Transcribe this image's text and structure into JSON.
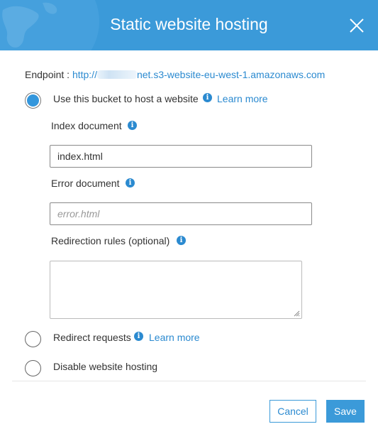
{
  "dialog": {
    "title": "Static website hosting",
    "close_icon": "close-icon"
  },
  "endpoint": {
    "label": "Endpoint : ",
    "url_prefix": "http://",
    "url_suffix": "net.s3-website-eu-west-1.amazonaws.com"
  },
  "options": {
    "host": {
      "label": "Use this bucket to host a website",
      "selected": true,
      "learn_more": "Learn more"
    },
    "redirect": {
      "label": "Redirect requests",
      "selected": false,
      "learn_more": "Learn more"
    },
    "disable": {
      "label": "Disable website hosting",
      "selected": false
    }
  },
  "fields": {
    "index_document": {
      "label": "Index document",
      "value": "index.html",
      "placeholder": ""
    },
    "error_document": {
      "label": "Error document",
      "value": "",
      "placeholder": "error.html"
    },
    "redirection_rules": {
      "label": "Redirection rules (optional)",
      "value": ""
    }
  },
  "footer": {
    "cancel_label": "Cancel",
    "save_label": "Save"
  },
  "colors": {
    "header": "#3b9ad9",
    "accent": "#2b8ad0",
    "radio_checked": "#3396dc"
  }
}
